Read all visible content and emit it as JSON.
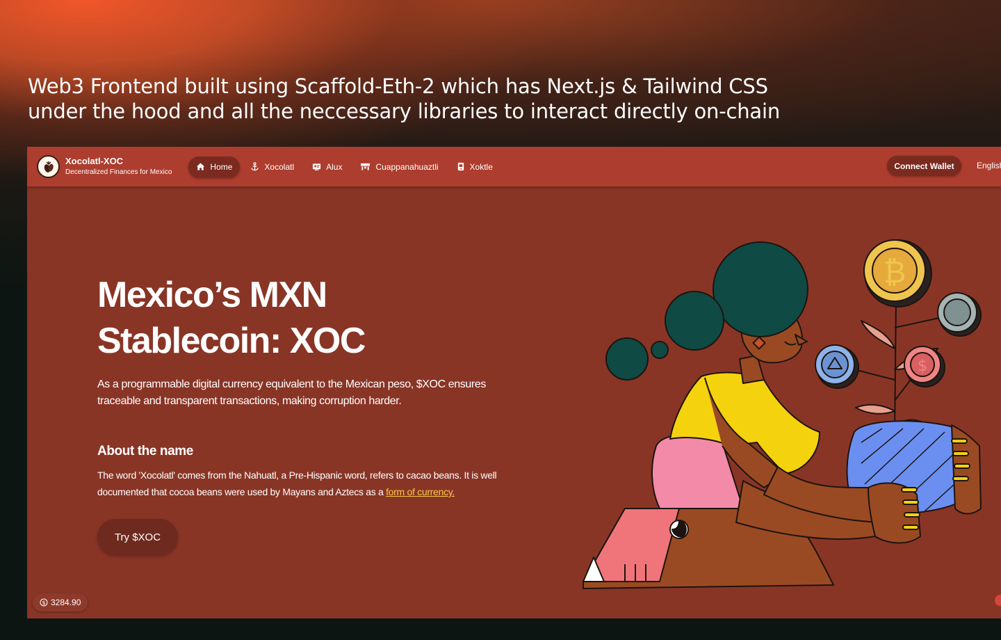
{
  "headline": {
    "line1": "Web3 Frontend built using Scaffold-Eth-2 which has Next.js & Tailwind CSS",
    "line2": "under the hood and all the neccessary libraries to interact directly on-chain"
  },
  "brand": {
    "title": "Xocolatl-XOC",
    "subtitle": "Decentralized Finances for Mexico"
  },
  "nav": {
    "items": [
      {
        "label": "Home",
        "icon": "home-icon",
        "active": true
      },
      {
        "label": "Xocolatl",
        "icon": "anchor-icon",
        "active": false
      },
      {
        "label": "Alux",
        "icon": "id-card-icon",
        "active": false
      },
      {
        "label": "Cuappanahuaztli",
        "icon": "shop-awning-icon",
        "active": false
      },
      {
        "label": "Xoktle",
        "icon": "jar-icon",
        "active": false
      }
    ],
    "connect_label": "Connect Wallet",
    "language": "English"
  },
  "hero": {
    "title_line1": "Mexico’s MXN",
    "title_line2": "Stablecoin: XOC",
    "description": "As a programmable digital currency equivalent to the Mexican peso, $XOC ensures traceable and transparent transactions, making corruption harder.",
    "about_heading": "About the name",
    "about_text": "The word 'Xocolatl' comes from the Nahuatl, a Pre-Hispanic word, refers to cacao beans. It is well documented that cocoa beans were used by Mayans and Aztecs as a",
    "about_link": "form of currency.",
    "cta_label": "Try $XOC"
  },
  "footer": {
    "balance": "3284.90"
  },
  "colors": {
    "navbar": "#ad3d2e",
    "page": "#893526",
    "accent_link": "#f7c948"
  }
}
